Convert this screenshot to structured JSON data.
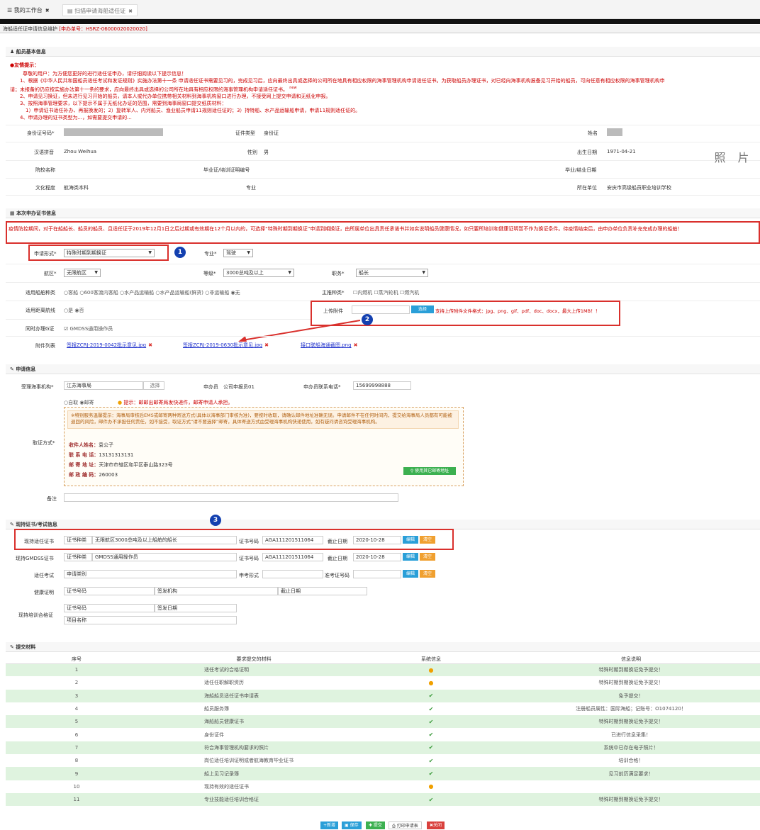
{
  "tabs": [
    {
      "label": "我的工作台",
      "close": "✖"
    },
    {
      "label": "扫描申请海船适任证",
      "close": "✖"
    }
  ],
  "subheader": {
    "title": "海船适任证申请信息维护",
    "ticket": "[申办单号：HSRZ-06000020020020]"
  },
  "basic": {
    "section": "船员基本信息",
    "notice_title": "友情提示：",
    "notice_lines": [
      "尊敬的用户：为方便您更好的进行适任证申办，请仔细阅读以下提示信息！",
      "1、根据《中华人民共和国船员适任考试和发证规则》实施办法第十一条 申请适任证书需要见习的，完成见习后，应向最终出具或选择的公司所在地具有相应权限的海事管理机构申请适任证书。为获取船员办理证书，对已经向海事机构报备见习开始的船员，可向任意有相应权限的海事管理机构申",
      "请；未报备的仍应按实施办法第十一条的要求，应向最终出具或选择的公司所在地具有相应权限的海事管理机构申请适任证书。",
      "2、申请见习换证，但未进行见习开始的船员，请本人或代办单位携带相关材料到海事机构窗口进行办理，不接受网上提交申请和无纸化申报。",
      "3、按照海事管理要求，以下提示不属于无纸化办证的范围，需要到海事局窗口提交纸质材料：",
      "1）申请证书适任补办、再报换发的；2）复转军人、内河船员、渔业船员申请11规则适任证的；3）持特船、水产品运输船申请，申请11规则适任证的。",
      "4、申请办理的证书类型为...，如需要提交申请的..."
    ],
    "new_tag": "new",
    "idcard_label": "身份证号码*",
    "certtype_label": "证件类型",
    "certtype_value": "身份证",
    "name_label": "姓名",
    "pinyin_label": "汉语拼音",
    "pinyin_value": "Zhou Weihua",
    "sex_label": "性别",
    "sex_value": "男",
    "birth_label": "出生日期",
    "birth_value": "1971-04-21",
    "school_label": "院校名称",
    "gradno_label": "毕业证/培训证明编号",
    "graddate_label": "毕业/结业日期",
    "edu_label": "文化程度",
    "edu_value": "航海类本科",
    "major_label": "专业",
    "unit_label": "所在单位",
    "unit_value": "安庆市高级船员职业培训学校",
    "photo": "照 片"
  },
  "cert": {
    "section": "本次申办证书信息",
    "banner": "疫情防控期间，对于在船船长、船员的船员、且适任证于2019年12月1日之后过期或有效期在12个月以内的，可选择“特殊时期到期换证”申请到期换证，由所属单位出具责任承诺书并如实说明船员健康情况，如只要所培训和健康证明暂不作为换证条件。待疫情结束后，由申办单位负责补充完成办理的船舶！",
    "form_label": "申请形式*",
    "form_value": "特殊时期到期换证",
    "spec_label": "专业*",
    "spec_value": "驾驶",
    "area_label": "航区*",
    "area_value": "无限航区",
    "grade_label": "等级*",
    "grade_value": "3000总吨及以上",
    "duty_label": "职务*",
    "duty_value": "船长",
    "ship_label": "适用船舶种类",
    "ship_options": [
      "客船",
      "600客渡内客船",
      "水产品运输船",
      "水产品运输船(鲜货)",
      "非运输船",
      "无"
    ],
    "engine_label": "主推种类*",
    "engine_options": [
      "内燃机",
      "蒸汽轮机",
      "燃汽机"
    ],
    "limit_label": "适用距离航线",
    "limit_options": [
      "是",
      "否"
    ],
    "gmdss_label": "同时办理G证",
    "gmdss_value": "GMDSS通用操作员",
    "upload_label": "上传附件",
    "upload_btn": "选择",
    "upload_hint": "支持上传附件文件格式：jpg、png、gif、pdf、doc、docx，最大上传1MB！！",
    "attach_label": "附件列表",
    "attachments": [
      "签报ZCRJ-2019-0042批示意见.jpg",
      "签报ZCRJ-2019-0630批示意见.jpg",
      "接口联船海通截图.png"
    ],
    "del": "✖",
    "circle1": "1",
    "circle2": "2",
    "circle3": "3"
  },
  "apply": {
    "section": "申请信息",
    "org_label": "受理海事机构*",
    "org_value": "江苏海事局",
    "org_btn": "选择",
    "agent_label": "申办员",
    "agent_value": "公司申报员01",
    "phone_label": "申办员联系电话*",
    "phone_value": "15699998888",
    "pickup_label": "取证方式*",
    "pickup_options": [
      "自取",
      "邮寄"
    ],
    "pickup_tip": "提示：邮邮出邮寄局发快递件，邮寄申请人承担。",
    "mail_warn": "※特别服务温馨提示：海事局审核后EMS或邮寄两种寄送方式(具体以海事部门审核为准)，要按时收取，请确认邮件地址准确无误。申请邮件不在任何时间内，提交给海事局人员都有可能被退回的风险，邮件办不承担任何责任，如不接受，取证方式“请不要选择”邮寄，具体寄送方式由受理海事机构快递使用，如有疑问请咨询受理海事机构。",
    "mail_name_label": "收件人姓名：",
    "mail_name": "袁公子",
    "mail_phone_label": "联 系 电 话：",
    "mail_phone": "13131313131",
    "mail_addr_label": "邮 寄 地 址：",
    "mail_addr": "天津市市辖区和平区泰山路323号",
    "mail_zip_label": "邮 政 编 码：",
    "mail_zip": "260003",
    "mail_btn": "使用其它邮寄地址",
    "remark_label": "备注"
  },
  "current": {
    "section": "现持证书/考试信息",
    "rows": [
      {
        "label": "现持适任证书",
        "type_label": "证书种类",
        "type_value": "无限航区3000总吨及以上船舶的船长",
        "no_label": "证书号码",
        "no_value": "AGA111201511064",
        "exp_label": "截止日期",
        "exp_value": "2020-10-28",
        "edit": "编辑",
        "clear": "清空"
      },
      {
        "label": "现持GMDSS证书",
        "type_label": "证书种类",
        "type_value": "GMDSS通用操作员",
        "no_label": "证书号码",
        "no_value": "AGA111201511064",
        "exp_label": "截止日期",
        "exp_value": "2020-10-28",
        "edit": "编辑",
        "clear": "清空"
      }
    ],
    "exam_label": "适任考试",
    "exam_cat": "申请类别",
    "exam_form": "申考形式",
    "exam_no": "准考证号码",
    "exam_edit": "编辑",
    "exam_clear": "清空",
    "health_label": "健康证明",
    "health_no": "证书号码",
    "health_org": "签发机构",
    "health_exp": "截止日期",
    "train_label": "现持培训合格证",
    "train_no": "证书号码",
    "train_date": "签发日期",
    "train_item": "项目名称"
  },
  "materials": {
    "section": "提交材料",
    "headers": [
      "序号",
      "要求提交的材料",
      "系统信息",
      "信息说明"
    ],
    "rows": [
      {
        "no": "1",
        "name": "适任考试的合格证明",
        "status": "warn",
        "note": "特殊时期到期换证免予提交！"
      },
      {
        "no": "2",
        "name": "适任任职解职资历",
        "status": "warn",
        "note": "特殊时期到期换证免予提交！"
      },
      {
        "no": "3",
        "name": "海船船员适任证书申请表",
        "status": "ok",
        "note": "免予提交！"
      },
      {
        "no": "4",
        "name": "船员服务簿",
        "status": "ok",
        "note": "注册船员属性：国际海船；记账号：O1074120！"
      },
      {
        "no": "5",
        "name": "海船船员健康证书",
        "status": "ok",
        "note": "特殊时期到期换证免予提交！"
      },
      {
        "no": "6",
        "name": "身份证件",
        "status": "ok",
        "note": "已进行信息采集！"
      },
      {
        "no": "7",
        "name": "符合海事管理机构要求的照片",
        "status": "ok",
        "note": "系统中已存在电子照片！"
      },
      {
        "no": "8",
        "name": "岗位适任培训证明或者航海教育毕业证书",
        "status": "ok",
        "note": "培训合格！"
      },
      {
        "no": "9",
        "name": "船上见习记录簿",
        "status": "ok",
        "note": "见习前历满足要求！"
      },
      {
        "no": "10",
        "name": "现持有效的适任证书",
        "status": "warn",
        "note": ""
      },
      {
        "no": "11",
        "name": "专业技能适任培训合格证",
        "status": "ok",
        "note": "特殊时期到期换证免予提交！"
      }
    ],
    "warn_glyph": "●",
    "ok_glyph": "✔"
  },
  "footer": {
    "new": "+新增",
    "save": "保存",
    "submit": "✚ 提交",
    "print": "打印申请表",
    "close": "✖关闭"
  }
}
